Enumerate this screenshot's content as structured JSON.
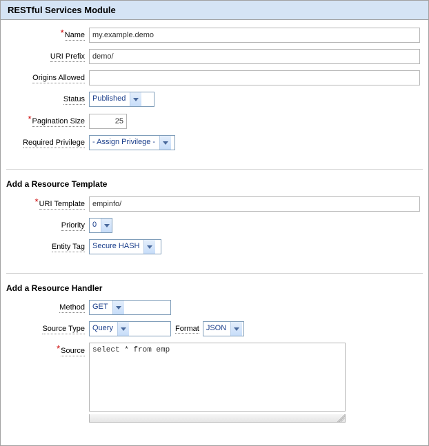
{
  "header": {
    "title": "RESTful Services Module"
  },
  "module": {
    "name_label": "Name",
    "name_value": "my.example.demo",
    "uri_prefix_label": "URI Prefix",
    "uri_prefix_value": "demo/",
    "origins_label": "Origins Allowed",
    "origins_value": "",
    "status_label": "Status",
    "status_value": "Published",
    "pagination_label": "Pagination Size",
    "pagination_value": "25",
    "privilege_label": "Required Privilege",
    "privilege_value": "- Assign Privilege -"
  },
  "template": {
    "title": "Add a Resource Template",
    "uri_template_label": "URI Template",
    "uri_template_value": "empinfo/",
    "priority_label": "Priority",
    "priority_value": "0",
    "etag_label": "Entity Tag",
    "etag_value": "Secure HASH"
  },
  "handler": {
    "title": "Add a Resource Handler",
    "method_label": "Method",
    "method_value": "GET",
    "source_type_label": "Source Type",
    "source_type_value": "Query",
    "format_label": "Format",
    "format_value": "JSON",
    "source_label": "Source",
    "source_value": "select * from emp"
  }
}
